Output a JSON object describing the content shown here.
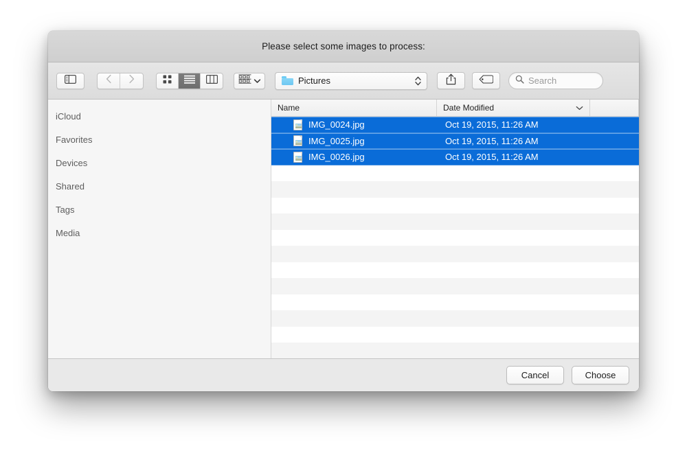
{
  "dialog": {
    "title": "Please select some images to process:"
  },
  "toolbar": {
    "sidebar_toggle": "sidebar-toggle-icon",
    "back": "chevron-left-icon",
    "forward": "chevron-right-icon",
    "view_icon": "grid-view-icon",
    "view_list": "list-view-icon",
    "view_column": "column-view-icon",
    "arrange": "arrange-group-icon",
    "path_label": "Pictures",
    "path_folder_icon": "folder-icon",
    "path_chevrons_icon": "up-down-chevron-icon",
    "share": "share-icon",
    "tag": "tag-icon",
    "search_placeholder": "Search",
    "search_icon": "search-icon"
  },
  "sidebar": {
    "items": [
      {
        "label": "iCloud"
      },
      {
        "label": "Favorites"
      },
      {
        "label": "Devices"
      },
      {
        "label": "Shared"
      },
      {
        "label": "Tags"
      },
      {
        "label": "Media"
      }
    ]
  },
  "filelist": {
    "columns": [
      {
        "label": "Name"
      },
      {
        "label": "Date Modified",
        "sort": "descending",
        "sort_icon": "chevron-down-icon"
      }
    ],
    "rows": [
      {
        "name": "IMG_0024.jpg",
        "date": "Oct 19, 2015, 11:26 AM",
        "selected": true,
        "icon": "image-file-icon"
      },
      {
        "name": "IMG_0025.jpg",
        "date": "Oct 19, 2015, 11:26 AM",
        "selected": true,
        "icon": "image-file-icon"
      },
      {
        "name": "IMG_0026.jpg",
        "date": "Oct 19, 2015, 11:26 AM",
        "selected": true,
        "icon": "image-file-icon"
      }
    ],
    "empty_row_count": 13
  },
  "footer": {
    "cancel_label": "Cancel",
    "choose_label": "Choose"
  },
  "colors": {
    "selection_blue": "#0a6cd8",
    "folder_blue": "#6ec7f2",
    "titlebar_gray": "#d4d4d4",
    "toolbar_gray": "#e0e0e0",
    "sidebar_gray": "#f6f6f6",
    "stripe_gray": "#f4f4f4",
    "footer_gray": "#e9e9e9"
  }
}
